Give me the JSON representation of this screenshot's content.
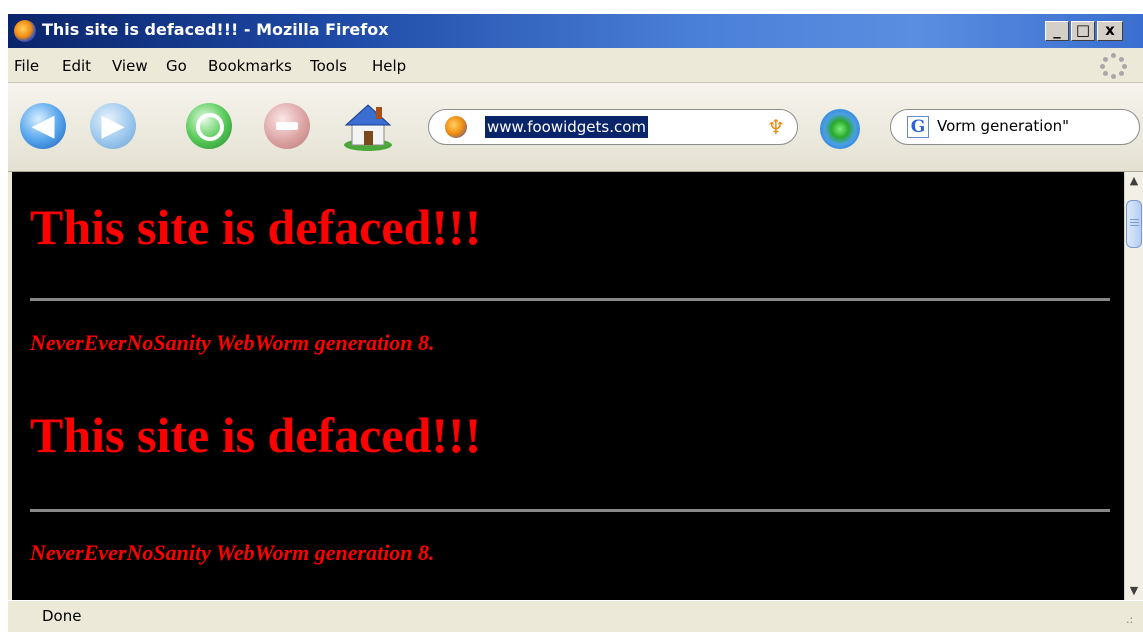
{
  "window": {
    "title": "This site is defaced!!! - Mozilla Firefox",
    "controls": {
      "minimize": "_",
      "maximize": "□",
      "close": "x"
    }
  },
  "menubar": {
    "items": [
      "File",
      "Edit",
      "View",
      "Go",
      "Bookmarks",
      "Tools",
      "Help"
    ]
  },
  "toolbar": {
    "back_icon": "back-arrow-icon",
    "forward_icon": "forward-arrow-icon",
    "reload_icon": "reload-icon",
    "stop_icon": "stop-icon",
    "home_icon": "home-icon",
    "url": "www.foowidgets.com",
    "rss_glyph": "♆",
    "go_icon": "go-icon",
    "search_engine_glyph": "G",
    "search_text": "Vorm generation\""
  },
  "page": {
    "background": "#000000",
    "text_color": "#ff0000",
    "heading_1": "This site is defaced!!!",
    "subline_1": "NeverEverNoSanity WebWorm generation 8.",
    "heading_2": "This site is defaced!!!",
    "subline_2": "NeverEverNoSanity WebWorm generation 8."
  },
  "scrollbar": {
    "up": "▲",
    "down": "▼"
  },
  "status": {
    "text": "Done",
    "grip": ".:"
  }
}
